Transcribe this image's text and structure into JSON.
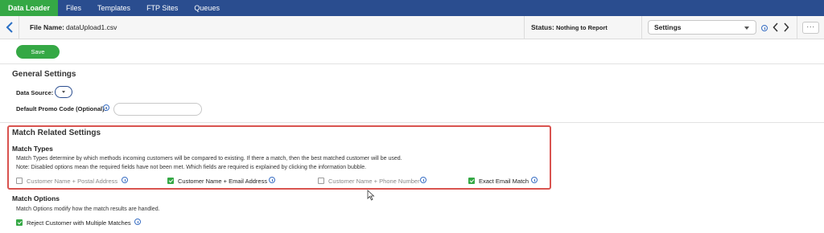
{
  "nav": {
    "tabs": [
      {
        "label": "Data Loader",
        "active": true
      },
      {
        "label": "Files",
        "active": false
      },
      {
        "label": "Templates",
        "active": false
      },
      {
        "label": "FTP Sites",
        "active": false
      },
      {
        "label": "Queues",
        "active": false
      }
    ]
  },
  "header": {
    "file_label": "File Name:",
    "file_value": "dataUpload1.csv",
    "status_label": "Status:",
    "status_value": "Nothing to Report",
    "settings_select_value": "Settings",
    "more_label": "···"
  },
  "toolbar": {
    "save_label": "Save"
  },
  "general": {
    "title": "General Settings",
    "data_source_label": "Data Source:",
    "promo_label": "Default Promo Code (Optional):",
    "promo_value": ""
  },
  "match": {
    "title": "Match Related Settings",
    "types_title": "Match Types",
    "desc1": "Match Types determine by which methods incoming customers will be compared to existing. If there a match, then the best matched customer will be used.",
    "desc2": "Note: Disabled options mean the required fields have not been met. Which fields are required is explained by clicking the information bubble.",
    "options": [
      {
        "label": "Customer Name + Postal Address",
        "checked": false,
        "disabled": true
      },
      {
        "label": "Customer Name + Email Address",
        "checked": true,
        "disabled": false
      },
      {
        "label": "Customer Name + Phone Number",
        "checked": false,
        "disabled": true
      },
      {
        "label": "Exact Email Match",
        "checked": true,
        "disabled": false
      }
    ],
    "options_title": "Match Options",
    "options_desc": "Match Options modify how the match results are handled.",
    "reject_label": "Reject Customer with Multiple Matches",
    "reject_checked": true
  },
  "colors": {
    "nav_bg": "#2a4d8f",
    "accent_green": "#35a845",
    "highlight_red": "#d9534f",
    "info_blue": "#3a6fc4"
  }
}
